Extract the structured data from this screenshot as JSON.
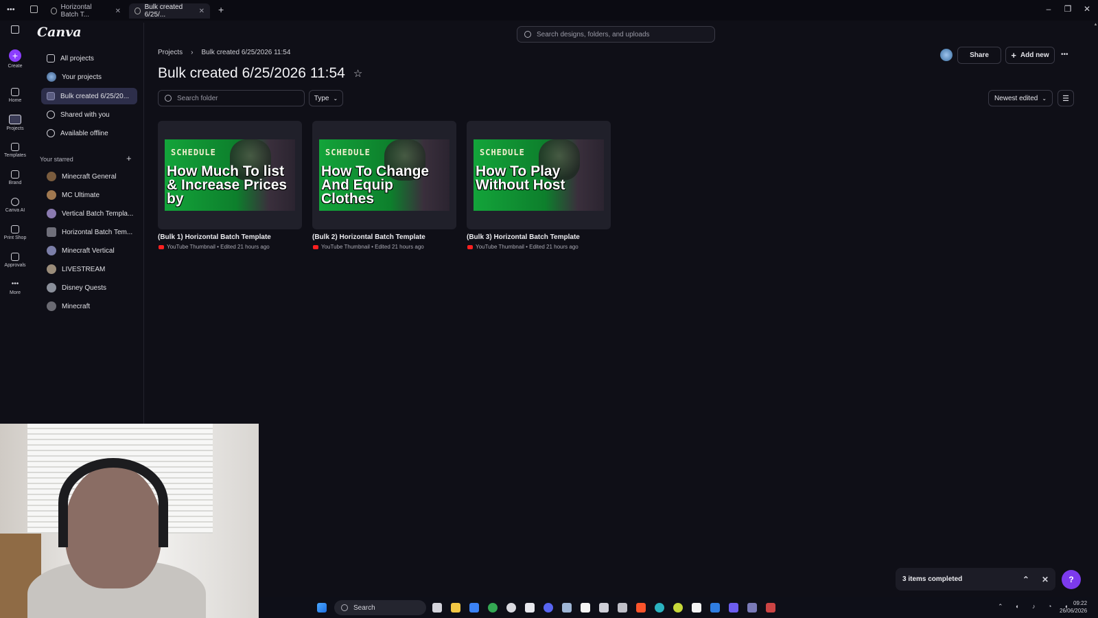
{
  "tabs": [
    {
      "label": "Horizontal Batch T...",
      "active": false
    },
    {
      "label": "Bulk created 6/25/...",
      "active": true
    }
  ],
  "rail": [
    {
      "label": "Create",
      "icon": "plus-icon"
    },
    {
      "label": "Home",
      "icon": "home-icon"
    },
    {
      "label": "Projects",
      "icon": "folder-icon"
    },
    {
      "label": "Templates",
      "icon": "templates-icon"
    },
    {
      "label": "Brand",
      "icon": "brand-icon"
    },
    {
      "label": "Canva AI",
      "icon": "canva-ai-icon"
    },
    {
      "label": "Print Shop",
      "icon": "print-shop-icon"
    },
    {
      "label": "Approvals",
      "icon": "approvals-icon"
    },
    {
      "label": "More",
      "icon": "more-icon"
    }
  ],
  "logo": "Canva",
  "nav": [
    {
      "label": "All projects",
      "icon": "all-projects-icon"
    },
    {
      "label": "Your projects",
      "icon": "avatar"
    },
    {
      "label": "Bulk created 6/25/20...",
      "icon": "folder-icon",
      "selected": true
    },
    {
      "label": "Shared with you",
      "icon": "shared-icon"
    },
    {
      "label": "Available offline",
      "icon": "offline-icon"
    }
  ],
  "starred": {
    "heading": "Your starred",
    "items": [
      {
        "label": "Minecraft General",
        "color": "#7a5c3e"
      },
      {
        "label": "MC Ultimate",
        "color": "#a07850"
      },
      {
        "label": "Vertical Batch Templa...",
        "color": "#8a7ab0"
      },
      {
        "label": "Horizontal Batch Tem...",
        "color": "#6f6f7a"
      },
      {
        "label": "Minecraft Vertical",
        "color": "#7b7ea8"
      },
      {
        "label": "LIVESTREAM",
        "color": "#9a8c7a"
      },
      {
        "label": "Disney Quests",
        "color": "#8a8f9a"
      },
      {
        "label": "Minecraft",
        "color": "#6a6a72"
      }
    ]
  },
  "search": {
    "placeholder": "Search designs, folders, and uploads"
  },
  "breadcrumb": {
    "root": "Projects",
    "separator": "›",
    "current": "Bulk created 6/25/2026 11:54"
  },
  "page_title": "Bulk created 6/25/2026 11:54",
  "actions": {
    "share": "Share",
    "add_new": "Add new",
    "more": "•••"
  },
  "filters": {
    "search_placeholder": "Search folder",
    "type": "Type",
    "sort": "Newest edited"
  },
  "cards": [
    {
      "schedule": "SCHEDULE",
      "headline": "How Much To list & Increase Prices by",
      "title": "(Bulk 1) Horizontal Batch Template",
      "meta": "YouTube Thumbnail • Edited 21 hours ago"
    },
    {
      "schedule": "SCHEDULE",
      "headline": "How To Change And Equip Clothes",
      "title": "(Bulk 2) Horizontal Batch Template",
      "meta": "YouTube Thumbnail • Edited 21 hours ago"
    },
    {
      "schedule": "SCHEDULE",
      "headline": "How To Play Without Host",
      "title": "(Bulk 3) Horizontal Batch Template",
      "meta": "YouTube Thumbnail • Edited 21 hours ago"
    }
  ],
  "toast": {
    "text": "3 items completed"
  },
  "help": "?",
  "taskbar": {
    "search": "Search",
    "time": "09:22",
    "date": "26/06/2026"
  },
  "colors": {
    "accent": "#8b3dff",
    "selected_nav": "#2d2e4a",
    "background": "#0f0f17"
  }
}
